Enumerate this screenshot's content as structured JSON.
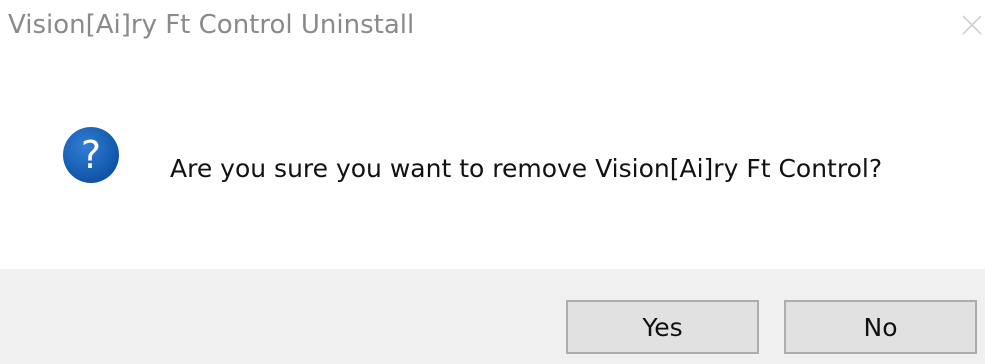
{
  "window": {
    "title": "Vision[Ai]ry Ft Control Uninstall",
    "close_icon": "close-icon"
  },
  "content": {
    "icon": "question-icon",
    "icon_glyph": "?",
    "icon_color": "#1565c0",
    "message": "Are you sure you want to remove Vision[Ai]ry Ft Control?"
  },
  "buttons": {
    "yes_label": "Yes",
    "no_label": "No"
  }
}
